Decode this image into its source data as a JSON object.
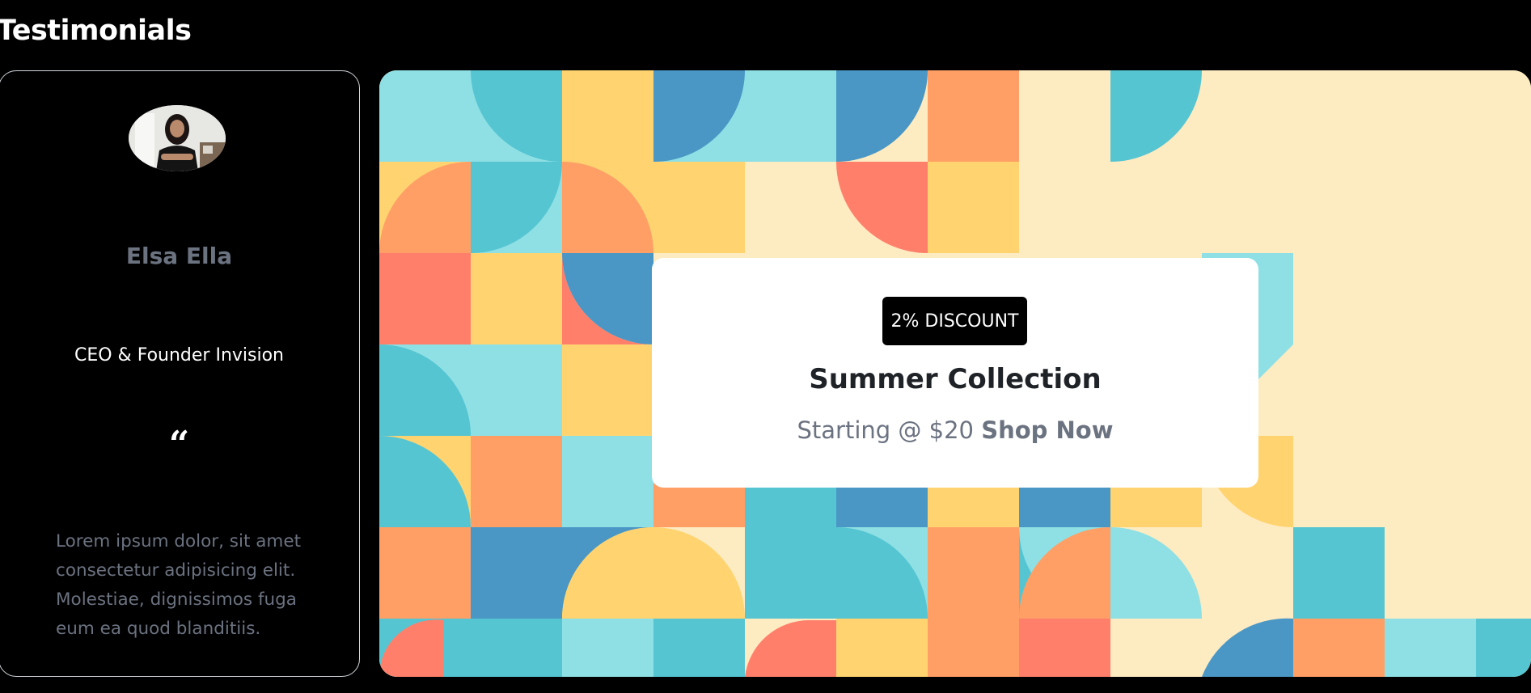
{
  "section": {
    "title": "Testimonials"
  },
  "testimonial": {
    "name": "Elsa Ella",
    "role": "CEO & Founder Invision",
    "quote_mark": "“",
    "text": "Lorem ipsum dolor, sit amet consectetur adipisicing elit. Molestiae, dignissimos fuga eum ea quod blanditiis."
  },
  "promo": {
    "badge": "2% DISCOUNT",
    "title": "Summer Collection",
    "price_text": "Starting @ $20",
    "cta": "Shop Now"
  },
  "colors": {
    "background": "#000000",
    "palette": [
      "#8ee0e4",
      "#4a97c5",
      "#ffd470",
      "#ff9f66",
      "#ff7f6b",
      "#56c5d2",
      "#fdebc2"
    ]
  }
}
